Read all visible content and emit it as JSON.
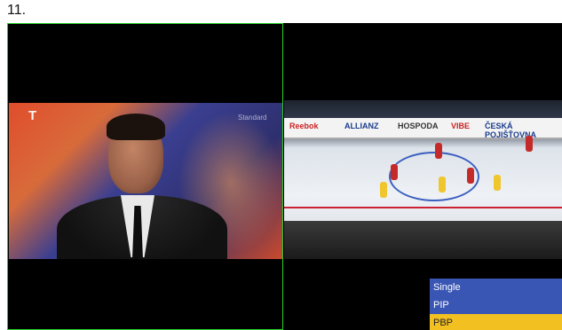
{
  "step_number": "11.",
  "videos": {
    "left": {
      "channel_logo": "T",
      "corner_logo": "Standard"
    },
    "right": {
      "board_ads": [
        "Reebok",
        "ALLIANZ",
        "HOSPODA",
        "VIBE",
        "ČESKÁ POJIŠŤOVNA"
      ]
    }
  },
  "menu": {
    "items": [
      {
        "label": "Single",
        "selected": false
      },
      {
        "label": "PIP",
        "selected": false
      },
      {
        "label": "PBP",
        "selected": true
      }
    ]
  },
  "colors": {
    "pane_border": "#2bd12b",
    "menu_bg": "#3a56b4",
    "menu_selected": "#f3c022"
  }
}
